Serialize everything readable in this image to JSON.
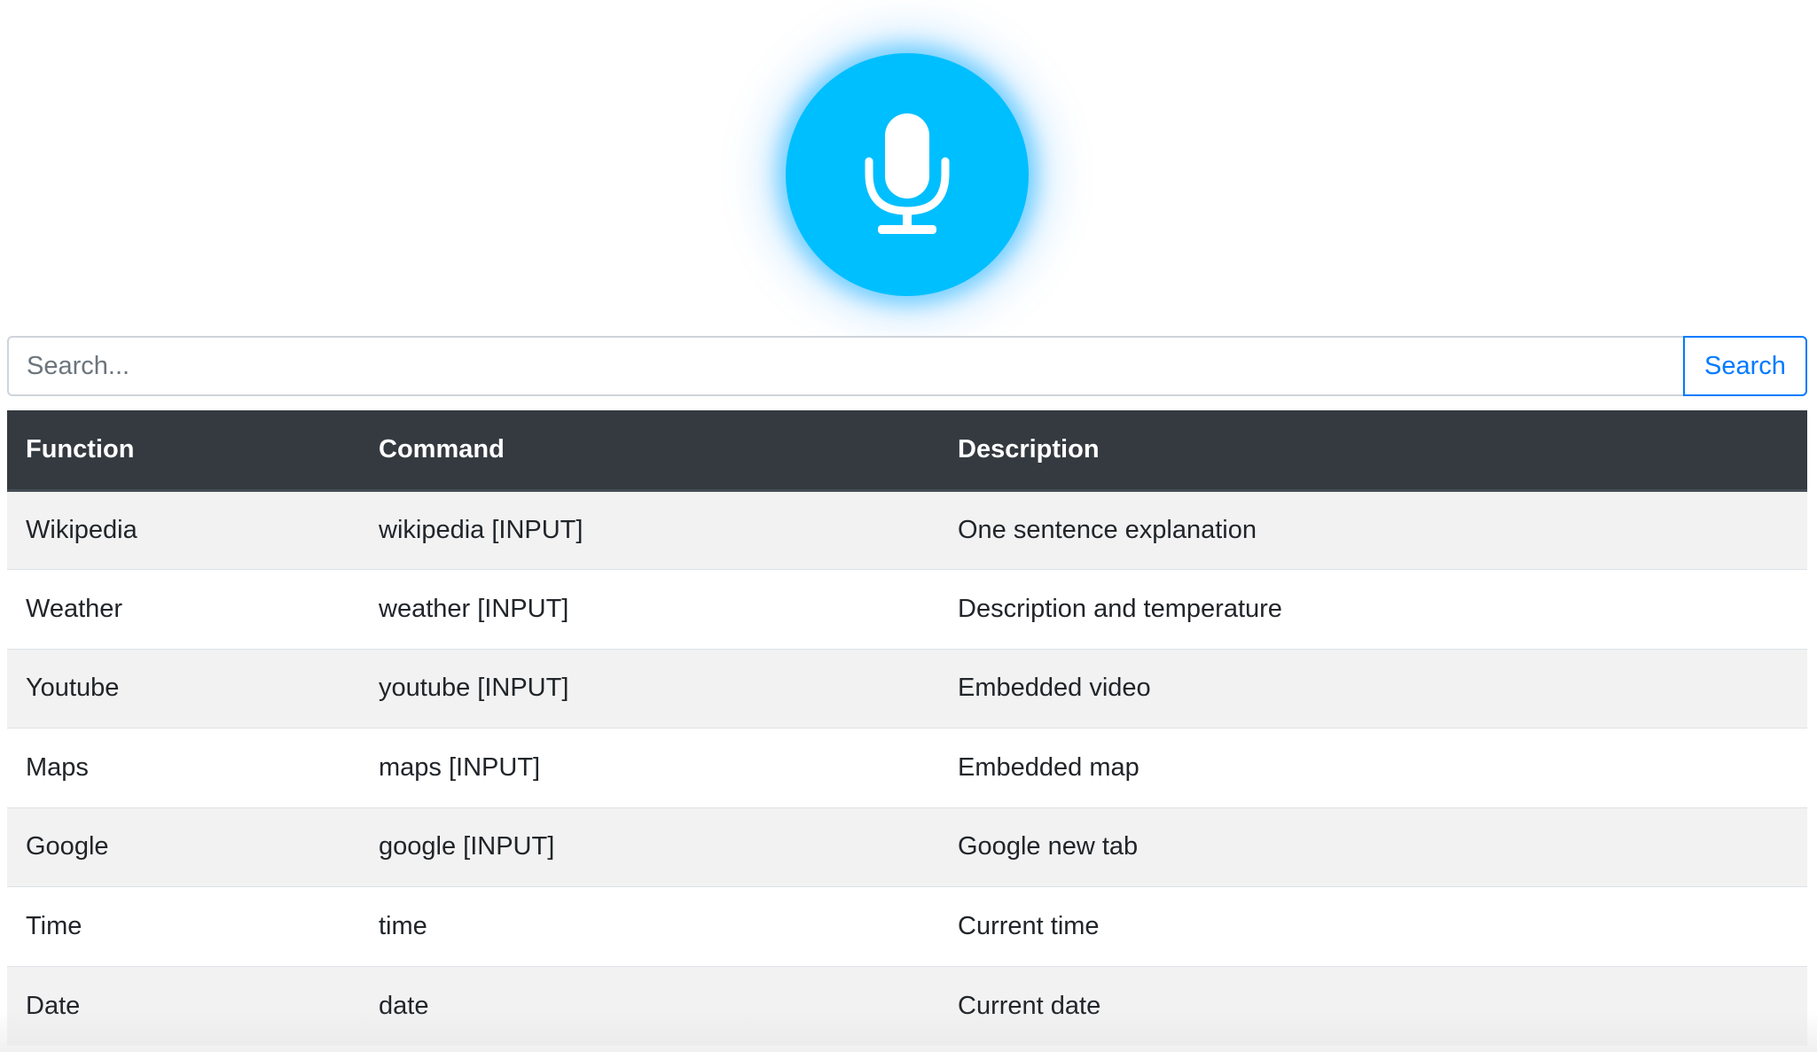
{
  "mic": {
    "icon": "microphone-icon",
    "color": "#00bfff"
  },
  "search": {
    "placeholder": "Search...",
    "value": "",
    "button_label": "Search",
    "accent_color": "#007bff"
  },
  "table": {
    "headers": {
      "function": "Function",
      "command": "Command",
      "description": "Description"
    },
    "header_bg": "#343a40",
    "rows": [
      {
        "function": "Wikipedia",
        "command": "wikipedia [INPUT]",
        "description": "One sentence explanation"
      },
      {
        "function": "Weather",
        "command": "weather [INPUT]",
        "description": "Description and temperature"
      },
      {
        "function": "Youtube",
        "command": "youtube [INPUT]",
        "description": "Embedded video"
      },
      {
        "function": "Maps",
        "command": "maps [INPUT]",
        "description": "Embedded map"
      },
      {
        "function": "Google",
        "command": "google [INPUT]",
        "description": "Google new tab"
      },
      {
        "function": "Time",
        "command": "time",
        "description": "Current time"
      },
      {
        "function": "Date",
        "command": "date",
        "description": "Current date"
      }
    ]
  }
}
